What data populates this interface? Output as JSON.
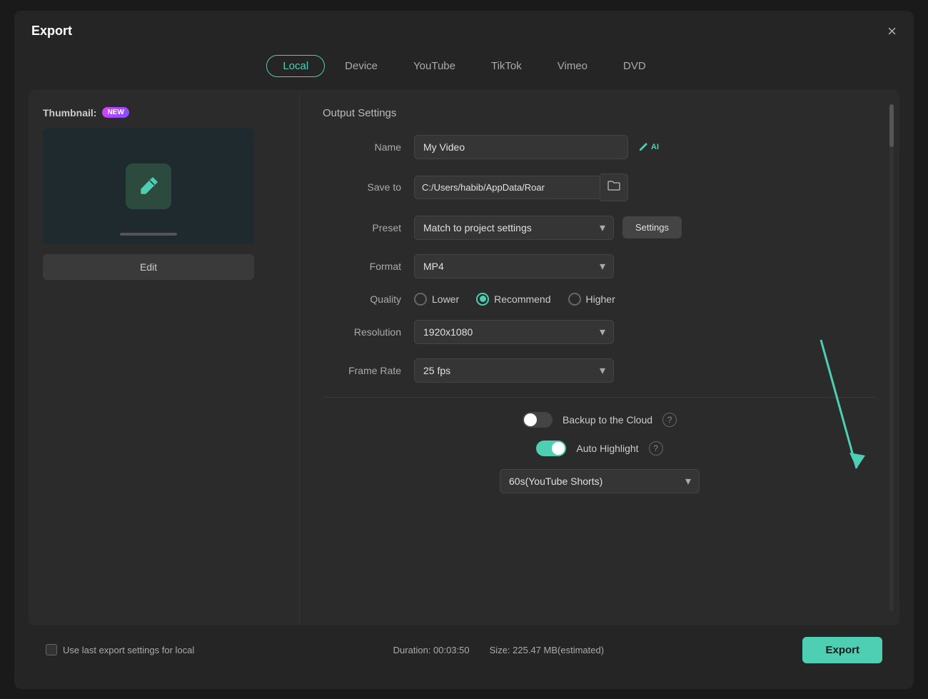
{
  "dialog": {
    "title": "Export",
    "close_label": "×"
  },
  "tabs": [
    {
      "id": "local",
      "label": "Local",
      "active": true
    },
    {
      "id": "device",
      "label": "Device",
      "active": false
    },
    {
      "id": "youtube",
      "label": "YouTube",
      "active": false
    },
    {
      "id": "tiktok",
      "label": "TikTok",
      "active": false
    },
    {
      "id": "vimeo",
      "label": "Vimeo",
      "active": false
    },
    {
      "id": "dvd",
      "label": "DVD",
      "active": false
    }
  ],
  "thumbnail": {
    "label": "Thumbnail:",
    "new_badge": "NEW",
    "edit_button": "Edit"
  },
  "output_settings": {
    "title": "Output Settings",
    "name_label": "Name",
    "name_value": "My Video",
    "name_placeholder": "My Video",
    "save_to_label": "Save to",
    "save_to_value": "C:/Users/habib/AppData/Roar",
    "preset_label": "Preset",
    "preset_value": "Match to project settings",
    "settings_button": "Settings",
    "format_label": "Format",
    "format_value": "MP4",
    "quality_label": "Quality",
    "quality_options": [
      {
        "id": "lower",
        "label": "Lower",
        "checked": false
      },
      {
        "id": "recommend",
        "label": "Recommend",
        "checked": true
      },
      {
        "id": "higher",
        "label": "Higher",
        "checked": false
      }
    ],
    "resolution_label": "Resolution",
    "resolution_value": "1920x1080",
    "framerate_label": "Frame Rate",
    "framerate_value": "25 fps",
    "backup_label": "Backup to the Cloud",
    "backup_on": false,
    "auto_highlight_label": "Auto Highlight",
    "auto_highlight_on": true,
    "shorts_value": "60s(YouTube Shorts)"
  },
  "bottom_bar": {
    "use_last_label": "Use last export settings for local",
    "duration_label": "Duration: 00:03:50",
    "size_label": "Size: 225.47 MB(estimated)",
    "export_button": "Export"
  }
}
